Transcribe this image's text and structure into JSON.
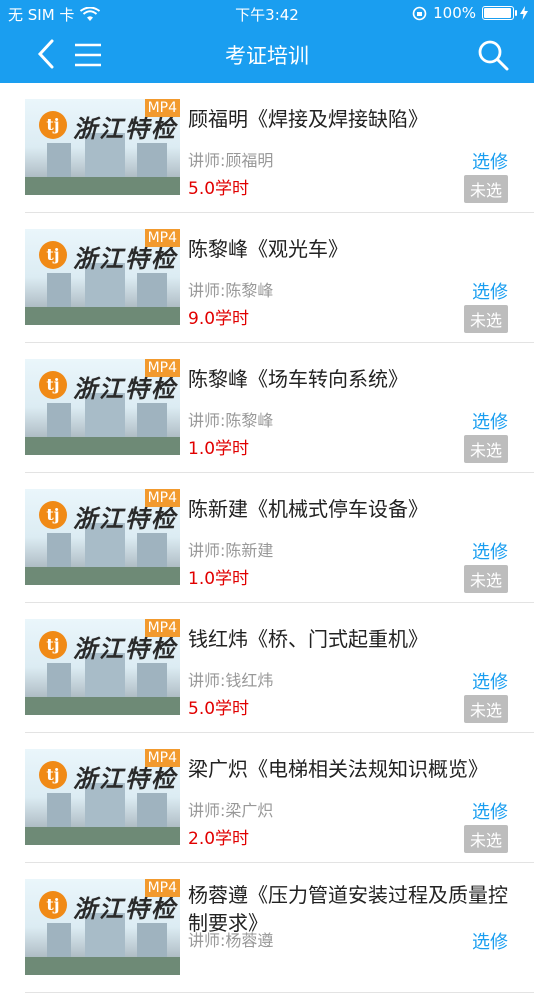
{
  "status_bar": {
    "carrier": "无 SIM 卡",
    "time": "下午3:42",
    "battery": "100%",
    "battery_level": 1.0
  },
  "nav": {
    "title": "考证培训",
    "icons": {
      "back": "chevron-left-icon",
      "menu": "menu-icon",
      "search": "search-icon"
    }
  },
  "thumb": {
    "brand": "浙江特检",
    "logo": "tj",
    "badge": "MP4"
  },
  "colors": {
    "accent": "#1a9ef0",
    "hours": "#e10000",
    "badge": "#f29a2e"
  },
  "courses": [
    {
      "title": "顾福明《焊接及焊接缺陷》",
      "teacher": "讲师:顾福明",
      "hours": "5.0学时",
      "action": "选修",
      "status": "未选"
    },
    {
      "title": "陈黎峰《观光车》",
      "teacher": "讲师:陈黎峰",
      "hours": "9.0学时",
      "action": "选修",
      "status": "未选"
    },
    {
      "title": "陈黎峰《场车转向系统》",
      "teacher": "讲师:陈黎峰",
      "hours": "1.0学时",
      "action": "选修",
      "status": "未选"
    },
    {
      "title": "陈新建《机械式停车设备》",
      "teacher": "讲师:陈新建",
      "hours": "1.0学时",
      "action": "选修",
      "status": "未选"
    },
    {
      "title": "钱红炜《桥、门式起重机》",
      "teacher": "讲师:钱红炜",
      "hours": "5.0学时",
      "action": "选修",
      "status": "未选"
    },
    {
      "title": "梁广炽《电梯相关法规知识概览》",
      "teacher": "讲师:梁广炽",
      "hours": "2.0学时",
      "action": "选修",
      "status": "未选"
    },
    {
      "title": "杨蓉遵《压力管道安装过程及质量控制要求》",
      "teacher": "讲师:杨蓉遵",
      "hours": "",
      "action": "选修",
      "status": ""
    }
  ]
}
